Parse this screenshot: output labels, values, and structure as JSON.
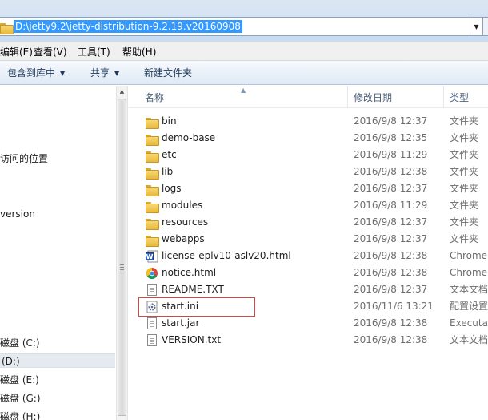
{
  "address": {
    "path": "D:\\jetty9.2\\jetty-distribution-9.2.19.v20160908"
  },
  "menu": {
    "items": [
      "编辑(E)",
      "查看(V)",
      "工具(T)",
      "帮助(H)"
    ]
  },
  "toolbar": {
    "include_library": "包含到库中",
    "share": "共享",
    "new_folder": "新建文件夹"
  },
  "nav": {
    "items": [
      {
        "label": "访问的位置"
      },
      {
        "label": "version"
      },
      {
        "label": "磁盘 (C:)"
      },
      {
        "label": "(D:)"
      },
      {
        "label": "磁盘 (E:)"
      },
      {
        "label": "磁盘 (G:)"
      },
      {
        "label": "磁盘 (H:)"
      }
    ]
  },
  "columns": {
    "name": "名称",
    "modified": "修改日期",
    "type": "类型"
  },
  "files": [
    {
      "name": "bin",
      "modified": "2016/9/8 12:37",
      "type": "文件夹",
      "icon": "folder-icon"
    },
    {
      "name": "demo-base",
      "modified": "2016/9/8 12:35",
      "type": "文件夹",
      "icon": "folder-icon"
    },
    {
      "name": "etc",
      "modified": "2016/9/8 11:29",
      "type": "文件夹",
      "icon": "folder-icon"
    },
    {
      "name": "lib",
      "modified": "2016/9/8 12:38",
      "type": "文件夹",
      "icon": "folder-icon"
    },
    {
      "name": "logs",
      "modified": "2016/9/8 12:37",
      "type": "文件夹",
      "icon": "folder-icon"
    },
    {
      "name": "modules",
      "modified": "2016/9/8 11:29",
      "type": "文件夹",
      "icon": "folder-icon"
    },
    {
      "name": "resources",
      "modified": "2016/9/8 12:37",
      "type": "文件夹",
      "icon": "folder-icon"
    },
    {
      "name": "webapps",
      "modified": "2016/9/8 12:37",
      "type": "文件夹",
      "icon": "folder-icon"
    },
    {
      "name": "license-eplv10-aslv20.html",
      "modified": "2016/9/8 12:38",
      "type": "Chrome",
      "icon": "word-html-icon"
    },
    {
      "name": "notice.html",
      "modified": "2016/9/8 12:38",
      "type": "Chrome",
      "icon": "chrome-icon"
    },
    {
      "name": "README.TXT",
      "modified": "2016/9/8 12:37",
      "type": "文本文档",
      "icon": "text-file-icon"
    },
    {
      "name": "start.ini",
      "modified": "2016/11/6 13:21",
      "type": "配置设置",
      "icon": "ini-gear-icon"
    },
    {
      "name": "start.jar",
      "modified": "2016/9/8 12:38",
      "type": "Executable",
      "icon": "jar-file-icon"
    },
    {
      "name": "VERSION.txt",
      "modified": "2016/9/8 12:38",
      "type": "文本文档",
      "icon": "text-file-icon"
    }
  ],
  "colors": {
    "selection": "#3399ff",
    "highlight_box": "#e04040",
    "folder": "#f7d774"
  }
}
